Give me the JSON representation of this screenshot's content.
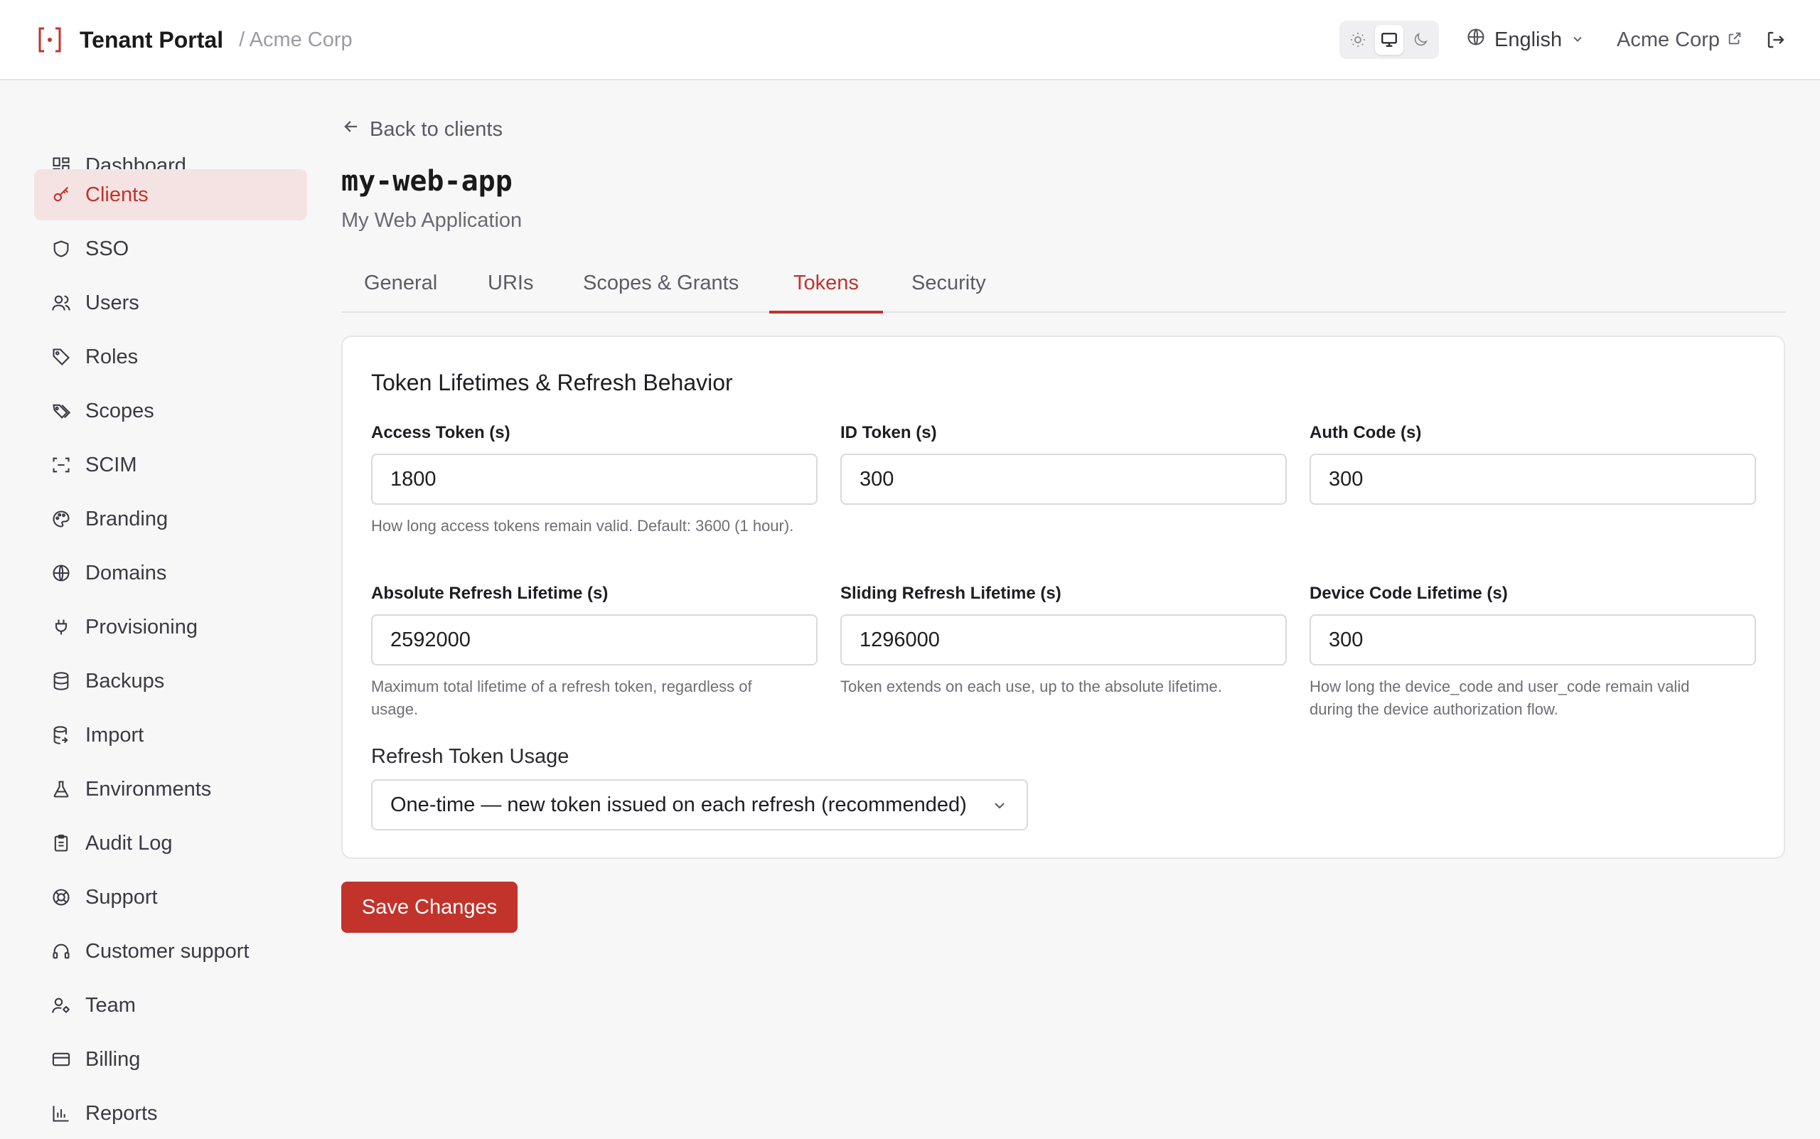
{
  "header": {
    "app_title": "Tenant Portal",
    "breadcrumb": "/ Acme Corp",
    "language": "English",
    "tenant_name": "Acme Corp",
    "theme_options": [
      "sun-icon",
      "monitor-icon",
      "moon-icon"
    ],
    "theme_selected": "monitor-icon"
  },
  "sidebar": {
    "items": [
      {
        "label": "Dashboard",
        "icon": "dashboard-icon",
        "active": false
      },
      {
        "label": "Clients",
        "icon": "key-icon",
        "active": true
      },
      {
        "label": "SSO",
        "icon": "shield-icon",
        "active": false
      },
      {
        "label": "Users",
        "icon": "users-icon",
        "active": false
      },
      {
        "label": "Roles",
        "icon": "tag-icon",
        "active": false
      },
      {
        "label": "Scopes",
        "icon": "tags-icon",
        "active": false
      },
      {
        "label": "SCIM",
        "icon": "scan-icon",
        "active": false
      },
      {
        "label": "Branding",
        "icon": "palette-icon",
        "active": false
      },
      {
        "label": "Domains",
        "icon": "globe-icon",
        "active": false
      },
      {
        "label": "Provisioning",
        "icon": "plug-icon",
        "active": false
      },
      {
        "label": "Backups",
        "icon": "database-icon",
        "active": false
      },
      {
        "label": "Import",
        "icon": "database-import-icon",
        "active": false
      },
      {
        "label": "Environments",
        "icon": "flask-icon",
        "active": false
      },
      {
        "label": "Audit Log",
        "icon": "clipboard-icon",
        "active": false
      },
      {
        "label": "Support",
        "icon": "lifebuoy-icon",
        "active": false
      },
      {
        "label": "Customer support",
        "icon": "headset-icon",
        "active": false
      },
      {
        "label": "Team",
        "icon": "user-cog-icon",
        "active": false
      },
      {
        "label": "Billing",
        "icon": "credit-card-icon",
        "active": false
      },
      {
        "label": "Reports",
        "icon": "bar-chart-icon",
        "active": false
      }
    ]
  },
  "main": {
    "back_label": "Back to clients",
    "client_id": "my-web-app",
    "client_name": "My Web Application",
    "tabs": [
      {
        "label": "General",
        "active": false
      },
      {
        "label": "URIs",
        "active": false
      },
      {
        "label": "Scopes & Grants",
        "active": false
      },
      {
        "label": "Tokens",
        "active": true
      },
      {
        "label": "Security",
        "active": false
      }
    ],
    "card": {
      "title": "Token Lifetimes & Refresh Behavior",
      "fields": {
        "access_token": {
          "label": "Access Token (s)",
          "value": "1800",
          "help": "How long access tokens remain valid. Default: 3600 (1 hour)."
        },
        "id_token": {
          "label": "ID Token (s)",
          "value": "300"
        },
        "auth_code": {
          "label": "Auth Code (s)",
          "value": "300"
        },
        "absolute_refresh": {
          "label": "Absolute Refresh Lifetime (s)",
          "value": "2592000",
          "help": "Maximum total lifetime of a refresh token, regardless of usage."
        },
        "sliding_refresh": {
          "label": "Sliding Refresh Lifetime (s)",
          "value": "1296000",
          "help": "Token extends on each use, up to the absolute lifetime."
        },
        "device_code": {
          "label": "Device Code Lifetime (s)",
          "value": "300",
          "help": "How long the device_code and user_code remain valid during the device authorization flow."
        }
      },
      "refresh_usage": {
        "label": "Refresh Token Usage",
        "selected": "One-time — new token issued on each refresh (recommended)"
      }
    },
    "save_label": "Save Changes"
  },
  "colors": {
    "accent": "#c2332b",
    "accent_bg": "#f5e3e3",
    "page_bg": "#f7f7f8"
  }
}
